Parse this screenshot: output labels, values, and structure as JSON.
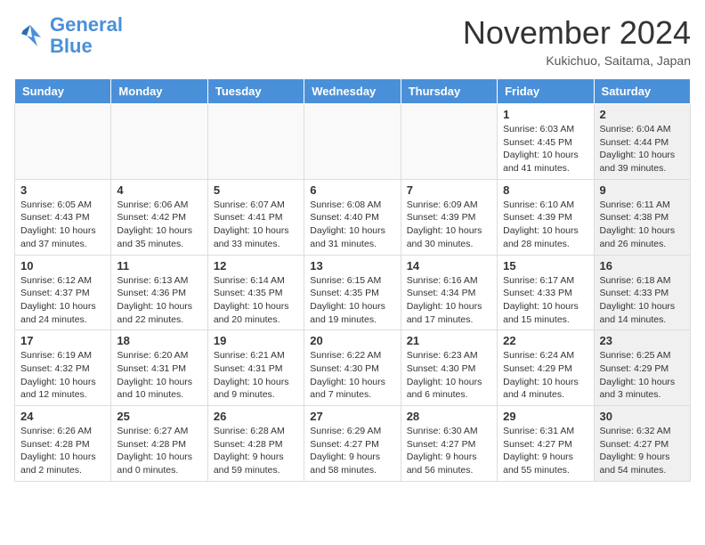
{
  "header": {
    "logo_line1": "General",
    "logo_line2": "Blue",
    "month": "November 2024",
    "location": "Kukichuo, Saitama, Japan"
  },
  "days_of_week": [
    "Sunday",
    "Monday",
    "Tuesday",
    "Wednesday",
    "Thursday",
    "Friday",
    "Saturday"
  ],
  "weeks": [
    [
      {
        "day": "",
        "info": "",
        "shaded": true
      },
      {
        "day": "",
        "info": "",
        "shaded": true
      },
      {
        "day": "",
        "info": "",
        "shaded": true
      },
      {
        "day": "",
        "info": "",
        "shaded": true
      },
      {
        "day": "",
        "info": "",
        "shaded": true
      },
      {
        "day": "1",
        "info": "Sunrise: 6:03 AM\nSunset: 4:45 PM\nDaylight: 10 hours and 41 minutes."
      },
      {
        "day": "2",
        "info": "Sunrise: 6:04 AM\nSunset: 4:44 PM\nDaylight: 10 hours and 39 minutes.",
        "shaded": true
      }
    ],
    [
      {
        "day": "3",
        "info": "Sunrise: 6:05 AM\nSunset: 4:43 PM\nDaylight: 10 hours and 37 minutes."
      },
      {
        "day": "4",
        "info": "Sunrise: 6:06 AM\nSunset: 4:42 PM\nDaylight: 10 hours and 35 minutes."
      },
      {
        "day": "5",
        "info": "Sunrise: 6:07 AM\nSunset: 4:41 PM\nDaylight: 10 hours and 33 minutes."
      },
      {
        "day": "6",
        "info": "Sunrise: 6:08 AM\nSunset: 4:40 PM\nDaylight: 10 hours and 31 minutes."
      },
      {
        "day": "7",
        "info": "Sunrise: 6:09 AM\nSunset: 4:39 PM\nDaylight: 10 hours and 30 minutes."
      },
      {
        "day": "8",
        "info": "Sunrise: 6:10 AM\nSunset: 4:39 PM\nDaylight: 10 hours and 28 minutes."
      },
      {
        "day": "9",
        "info": "Sunrise: 6:11 AM\nSunset: 4:38 PM\nDaylight: 10 hours and 26 minutes.",
        "shaded": true
      }
    ],
    [
      {
        "day": "10",
        "info": "Sunrise: 6:12 AM\nSunset: 4:37 PM\nDaylight: 10 hours and 24 minutes."
      },
      {
        "day": "11",
        "info": "Sunrise: 6:13 AM\nSunset: 4:36 PM\nDaylight: 10 hours and 22 minutes."
      },
      {
        "day": "12",
        "info": "Sunrise: 6:14 AM\nSunset: 4:35 PM\nDaylight: 10 hours and 20 minutes."
      },
      {
        "day": "13",
        "info": "Sunrise: 6:15 AM\nSunset: 4:35 PM\nDaylight: 10 hours and 19 minutes."
      },
      {
        "day": "14",
        "info": "Sunrise: 6:16 AM\nSunset: 4:34 PM\nDaylight: 10 hours and 17 minutes."
      },
      {
        "day": "15",
        "info": "Sunrise: 6:17 AM\nSunset: 4:33 PM\nDaylight: 10 hours and 15 minutes."
      },
      {
        "day": "16",
        "info": "Sunrise: 6:18 AM\nSunset: 4:33 PM\nDaylight: 10 hours and 14 minutes.",
        "shaded": true
      }
    ],
    [
      {
        "day": "17",
        "info": "Sunrise: 6:19 AM\nSunset: 4:32 PM\nDaylight: 10 hours and 12 minutes."
      },
      {
        "day": "18",
        "info": "Sunrise: 6:20 AM\nSunset: 4:31 PM\nDaylight: 10 hours and 10 minutes."
      },
      {
        "day": "19",
        "info": "Sunrise: 6:21 AM\nSunset: 4:31 PM\nDaylight: 10 hours and 9 minutes."
      },
      {
        "day": "20",
        "info": "Sunrise: 6:22 AM\nSunset: 4:30 PM\nDaylight: 10 hours and 7 minutes."
      },
      {
        "day": "21",
        "info": "Sunrise: 6:23 AM\nSunset: 4:30 PM\nDaylight: 10 hours and 6 minutes."
      },
      {
        "day": "22",
        "info": "Sunrise: 6:24 AM\nSunset: 4:29 PM\nDaylight: 10 hours and 4 minutes."
      },
      {
        "day": "23",
        "info": "Sunrise: 6:25 AM\nSunset: 4:29 PM\nDaylight: 10 hours and 3 minutes.",
        "shaded": true
      }
    ],
    [
      {
        "day": "24",
        "info": "Sunrise: 6:26 AM\nSunset: 4:28 PM\nDaylight: 10 hours and 2 minutes."
      },
      {
        "day": "25",
        "info": "Sunrise: 6:27 AM\nSunset: 4:28 PM\nDaylight: 10 hours and 0 minutes."
      },
      {
        "day": "26",
        "info": "Sunrise: 6:28 AM\nSunset: 4:28 PM\nDaylight: 9 hours and 59 minutes."
      },
      {
        "day": "27",
        "info": "Sunrise: 6:29 AM\nSunset: 4:27 PM\nDaylight: 9 hours and 58 minutes."
      },
      {
        "day": "28",
        "info": "Sunrise: 6:30 AM\nSunset: 4:27 PM\nDaylight: 9 hours and 56 minutes."
      },
      {
        "day": "29",
        "info": "Sunrise: 6:31 AM\nSunset: 4:27 PM\nDaylight: 9 hours and 55 minutes."
      },
      {
        "day": "30",
        "info": "Sunrise: 6:32 AM\nSunset: 4:27 PM\nDaylight: 9 hours and 54 minutes.",
        "shaded": true
      }
    ]
  ]
}
